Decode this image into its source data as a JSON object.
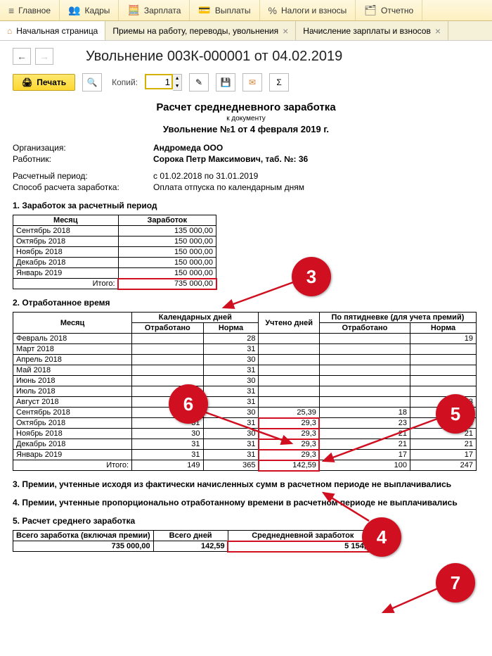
{
  "menu": {
    "items": [
      {
        "icon": "≡",
        "label": "Главное"
      },
      {
        "icon": "👥",
        "label": "Кадры"
      },
      {
        "icon": "🧮",
        "label": "Зарплата"
      },
      {
        "icon": "💳",
        "label": "Выплаты"
      },
      {
        "icon": "%",
        "label": "Налоги и взносы"
      },
      {
        "icon": "🗂",
        "label": "Отчетно"
      }
    ]
  },
  "tabs": [
    {
      "label": "Начальная страница",
      "closable": false,
      "home": true
    },
    {
      "label": "Приемы на работу, переводы, увольнения",
      "closable": true
    },
    {
      "label": "Начисление зарплаты и взносов",
      "closable": true
    }
  ],
  "docTitle": "Увольнение 003К-000001 от 04.02.2019",
  "toolbar": {
    "print": "Печать",
    "copies_label": "Копий:",
    "copies_value": "1"
  },
  "report": {
    "title": "Расчет среднедневного заработка",
    "sub1": "к документу",
    "sub2": "Увольнение №1 от 4 февраля 2019 г.",
    "org_label": "Организация:",
    "org": "Андромеда ООО",
    "emp_label": "Работник:",
    "emp": "Сорока Петр Максимович, таб. №: 36",
    "period_label": "Расчетный период:",
    "period": "с 01.02.2018 по 31.01.2019",
    "method_label": "Способ расчета заработка:",
    "method": "Оплата отпуска по календарным дням"
  },
  "section1": {
    "title": "1. Заработок за расчетный период",
    "headers": [
      "Месяц",
      "Заработок"
    ],
    "rows": [
      [
        "Сентябрь 2018",
        "135 000,00"
      ],
      [
        "Октябрь 2018",
        "150 000,00"
      ],
      [
        "Ноябрь 2018",
        "150 000,00"
      ],
      [
        "Декабрь 2018",
        "150 000,00"
      ],
      [
        "Январь 2019",
        "150 000,00"
      ]
    ],
    "total_label": "Итого:",
    "total": "735 000,00"
  },
  "section2": {
    "title": "2. Отработанное время",
    "headers": {
      "month": "Месяц",
      "cal": "Календарных дней",
      "cal_worked": "Отработано",
      "cal_norm": "Норма",
      "counted": "Учтено дней",
      "five": "По пятидневке (для учета премий)",
      "five_worked": "Отработано",
      "five_norm": "Норма"
    },
    "rows": [
      {
        "m": "Февраль 2018",
        "cw": "",
        "cn": "28",
        "u": "",
        "fw": "",
        "fn": "19"
      },
      {
        "m": "Март 2018",
        "cw": "",
        "cn": "31",
        "u": "",
        "fw": "",
        "fn": ""
      },
      {
        "m": "Апрель 2018",
        "cw": "",
        "cn": "30",
        "u": "",
        "fw": "",
        "fn": ""
      },
      {
        "m": "Май 2018",
        "cw": "",
        "cn": "31",
        "u": "",
        "fw": "",
        "fn": ""
      },
      {
        "m": "Июнь 2018",
        "cw": "",
        "cn": "30",
        "u": "",
        "fw": "",
        "fn": ""
      },
      {
        "m": "Июль 2018",
        "cw": "",
        "cn": "31",
        "u": "",
        "fw": "",
        "fn": ""
      },
      {
        "m": "Август 2018",
        "cw": "",
        "cn": "31",
        "u": "",
        "fw": "",
        "fn": "23"
      },
      {
        "m": "Сентябрь 2018",
        "cw": "26",
        "cn": "30",
        "u": "25,39",
        "fw": "18",
        "fn": "20"
      },
      {
        "m": "Октябрь 2018",
        "cw": "31",
        "cn": "31",
        "u": "29,3",
        "fw": "23",
        "fn": "23"
      },
      {
        "m": "Ноябрь 2018",
        "cw": "30",
        "cn": "30",
        "u": "29,3",
        "fw": "21",
        "fn": "21"
      },
      {
        "m": "Декабрь 2018",
        "cw": "31",
        "cn": "31",
        "u": "29,3",
        "fw": "21",
        "fn": "21"
      },
      {
        "m": "Январь 2019",
        "cw": "31",
        "cn": "31",
        "u": "29,3",
        "fw": "17",
        "fn": "17"
      }
    ],
    "total_label": "Итого:",
    "totals": {
      "cw": "149",
      "cn": "365",
      "u": "142,59",
      "fw": "100",
      "fn": "247"
    }
  },
  "section3": "3. Премии, учтенные исходя из фактически начисленных сумм в расчетном периоде не выплачивались",
  "section4": "4. Премии, учтенные пропорционально отработанному времени в расчетном периоде не выплачивались",
  "section5": {
    "title": "5. Расчет среднего  заработка",
    "headers": [
      "Всего заработка (включая премии)",
      "Всего дней",
      "Среднедневной заработок"
    ],
    "row": [
      "735 000,00",
      "142,59",
      "5 154,64"
    ]
  },
  "callouts": {
    "c3": "3",
    "c4": "4",
    "c5": "5",
    "c6": "6",
    "c7": "7"
  },
  "chart_data": {
    "type": "table",
    "title": "Расчет среднедневного заработка — Увольнение №1 от 4 февраля 2019 г.",
    "earnings_by_month": [
      {
        "month": "Сентябрь 2018",
        "amount": 135000.0
      },
      {
        "month": "Октябрь 2018",
        "amount": 150000.0
      },
      {
        "month": "Ноябрь 2018",
        "amount": 150000.0
      },
      {
        "month": "Декабрь 2018",
        "amount": 150000.0
      },
      {
        "month": "Январь 2019",
        "amount": 150000.0
      }
    ],
    "earnings_total": 735000.0,
    "time_worked": [
      {
        "month": "Февраль 2018",
        "cal_worked": null,
        "cal_norm": 28,
        "counted": null,
        "five_worked": null,
        "five_norm": 19
      },
      {
        "month": "Март 2018",
        "cal_worked": null,
        "cal_norm": 31,
        "counted": null,
        "five_worked": null,
        "five_norm": null
      },
      {
        "month": "Апрель 2018",
        "cal_worked": null,
        "cal_norm": 30,
        "counted": null,
        "five_worked": null,
        "five_norm": null
      },
      {
        "month": "Май 2018",
        "cal_worked": null,
        "cal_norm": 31,
        "counted": null,
        "five_worked": null,
        "five_norm": null
      },
      {
        "month": "Июнь 2018",
        "cal_worked": null,
        "cal_norm": 30,
        "counted": null,
        "five_worked": null,
        "five_norm": null
      },
      {
        "month": "Июль 2018",
        "cal_worked": null,
        "cal_norm": 31,
        "counted": null,
        "five_worked": null,
        "five_norm": null
      },
      {
        "month": "Август 2018",
        "cal_worked": null,
        "cal_norm": 31,
        "counted": null,
        "five_worked": null,
        "five_norm": 23
      },
      {
        "month": "Сентябрь 2018",
        "cal_worked": 26,
        "cal_norm": 30,
        "counted": 25.39,
        "five_worked": 18,
        "five_norm": 20
      },
      {
        "month": "Октябрь 2018",
        "cal_worked": 31,
        "cal_norm": 31,
        "counted": 29.3,
        "five_worked": 23,
        "five_norm": 23
      },
      {
        "month": "Ноябрь 2018",
        "cal_worked": 30,
        "cal_norm": 30,
        "counted": 29.3,
        "five_worked": 21,
        "five_norm": 21
      },
      {
        "month": "Декабрь 2018",
        "cal_worked": 31,
        "cal_norm": 31,
        "counted": 29.3,
        "five_worked": 21,
        "five_norm": 21
      },
      {
        "month": "Январь 2019",
        "cal_worked": 31,
        "cal_norm": 31,
        "counted": 29.3,
        "five_worked": 17,
        "five_norm": 17
      }
    ],
    "time_totals": {
      "cal_worked": 149,
      "cal_norm": 365,
      "counted": 142.59,
      "five_worked": 100,
      "five_norm": 247
    },
    "average": {
      "total_earnings": 735000.0,
      "total_days": 142.59,
      "avg_daily": 5154.64
    }
  }
}
